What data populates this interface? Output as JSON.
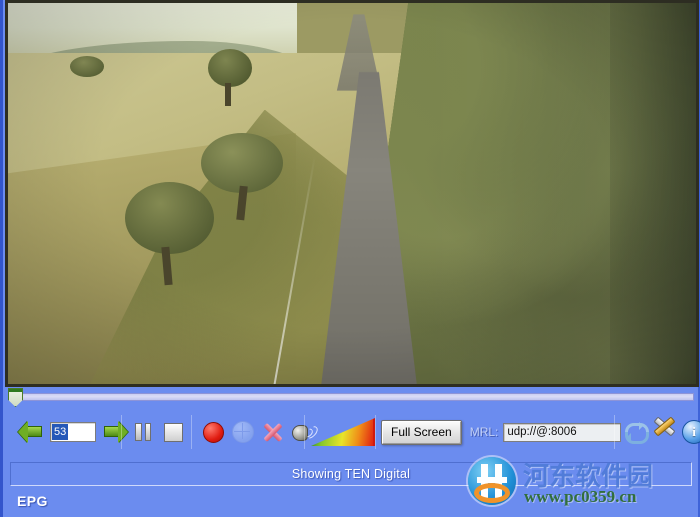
{
  "player": {
    "video": {
      "scene_description": "Aerial view of a country road winding between dry golden pasture and dense eucalyptus forest"
    },
    "seek": {
      "position_percent": 0
    },
    "toolbar": {
      "prev_channel_label": "prev-channel",
      "next_channel_label": "next-channel",
      "channel_number": "53",
      "pause_label": "pause",
      "stop_label": "stop",
      "record_label": "record",
      "network_label": "network",
      "close_label": "close-stream",
      "audio_label": "audio",
      "signal_label": "signal-strength",
      "fullscreen_label": "Full Screen",
      "mrl_label": "MRL:",
      "mrl_value": "udp://@:8006",
      "refresh_label": "refresh",
      "settings_label": "settings",
      "info_label": "i"
    },
    "status": {
      "message": "Showing TEN Digital"
    },
    "epg": {
      "label": "EPG"
    },
    "watermark": {
      "site_name": "河东软件园",
      "url": "www.pc0359.cn"
    },
    "colors": {
      "background_blue": "#6b8cef",
      "accent_green": "#4e8b16",
      "record_red": "#e01b10",
      "selection_blue": "#2558b8",
      "status_text": "#ffffff"
    }
  }
}
